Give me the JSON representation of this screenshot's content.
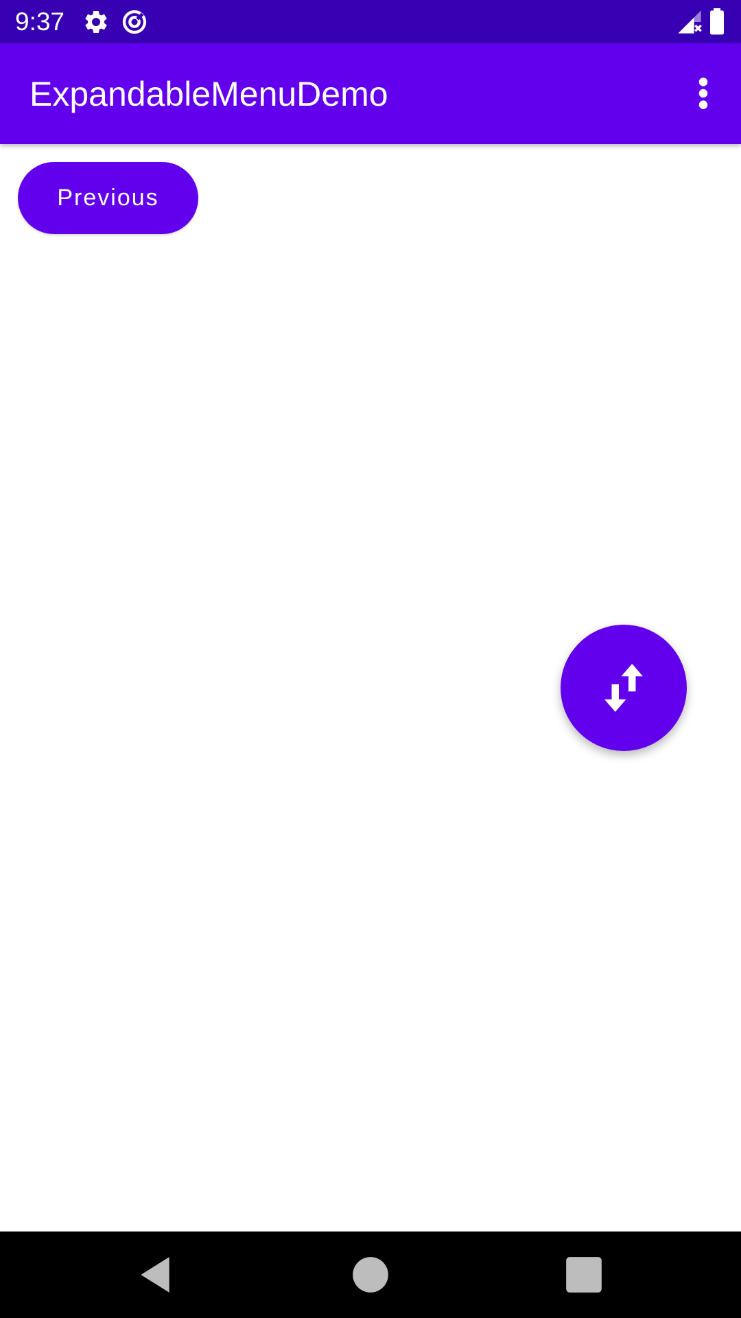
{
  "status_bar": {
    "time": "9:37",
    "icons": [
      "gear-icon",
      "data-saver-icon",
      "signal-icon",
      "battery-icon"
    ]
  },
  "app_bar": {
    "title": "ExpandableMenuDemo",
    "overflow_icon": "more-vert-icon"
  },
  "main": {
    "previous_label": "Previous",
    "fab_icon": "swap-vert-icon"
  },
  "nav_bar": {
    "icons": [
      "back-icon",
      "home-icon",
      "recents-icon"
    ]
  },
  "colors": {
    "primary": "#6200EE",
    "primary_dark": "#3700B3",
    "background": "#FFFFFF",
    "nav_bar": "#000000"
  }
}
